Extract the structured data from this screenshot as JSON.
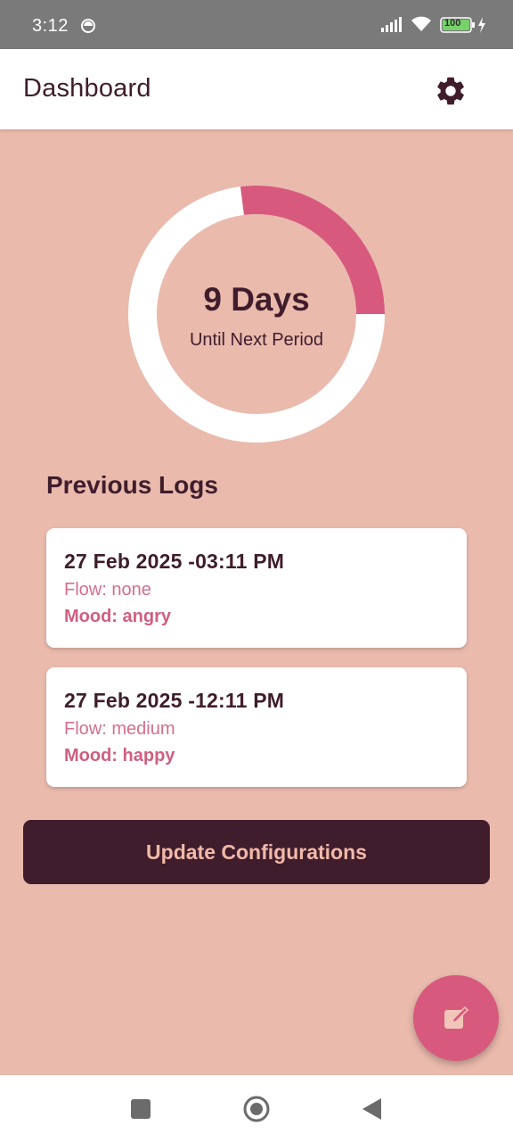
{
  "status_bar": {
    "time": "3:12",
    "battery_level": "100",
    "icons": [
      "notification-dot-icon",
      "signal-icon",
      "wifi-icon",
      "battery-icon",
      "charging-bolt-icon"
    ]
  },
  "app_bar": {
    "title": "Dashboard",
    "settings_icon": "gear-icon"
  },
  "cycle": {
    "days_label": "9 Days",
    "subtitle": "Until Next Period",
    "progress_fraction": 0.27,
    "colors": {
      "progress": "#d75a7e",
      "track": "#ffffff"
    }
  },
  "logs": {
    "title": "Previous Logs",
    "items": [
      {
        "date": "27 Feb 2025 -03:11 PM",
        "flow": "Flow: none",
        "mood": "Mood: angry"
      },
      {
        "date": "27 Feb 2025 -12:11 PM",
        "flow": "Flow: medium",
        "mood": "Mood: happy"
      }
    ]
  },
  "actions": {
    "update_label": "Update Configurations",
    "fab_icon": "edit-note-icon"
  },
  "nav_bar": {
    "icons": [
      "recent-apps-icon",
      "home-icon",
      "back-icon"
    ]
  },
  "colors": {
    "background": "#eabaad",
    "primary_dark": "#3f1d2c",
    "accent": "#d75a7e"
  }
}
